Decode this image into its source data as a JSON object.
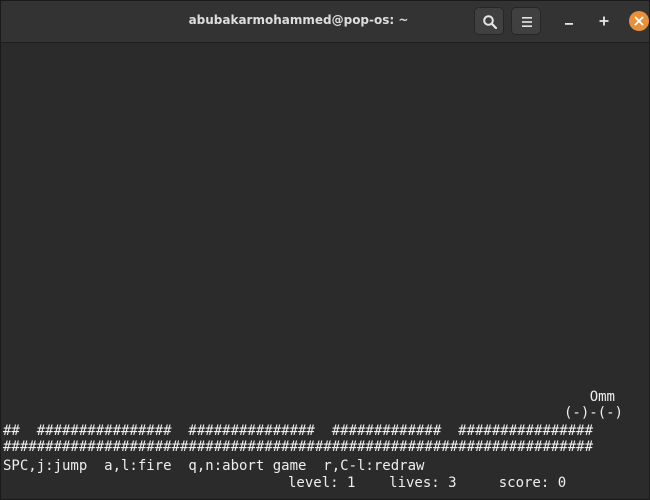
{
  "window": {
    "title": "abubakarmohammed@pop-os: ~"
  },
  "header_buttons": {
    "search_icon": "search-icon",
    "menu_icon": "hamburger-menu-icon",
    "minimize_icon": "minimize-icon",
    "maximize_icon": "maximize-icon",
    "close_icon": "close-icon",
    "close_color": "#e8903a"
  },
  "terminal": {
    "player_head": "Omm",
    "player_body": "(-)-(-)",
    "ground_top": "##  ################  ###############  #############  ################",
    "ground_bottom": "######################################################################",
    "controls": "SPC,j:jump  a,l:fire  q,n:abort game  r,C-l:redraw",
    "status": "level: 1    lives: 3     score: 0"
  }
}
